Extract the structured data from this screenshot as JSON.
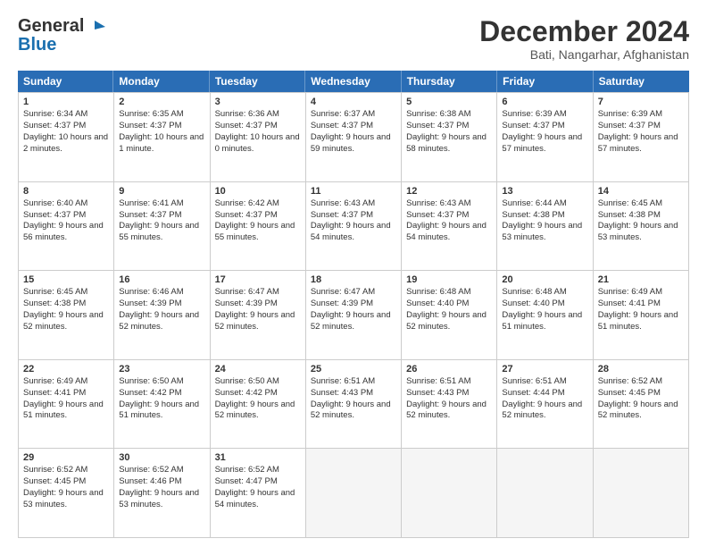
{
  "header": {
    "logo_general": "General",
    "logo_blue": "Blue",
    "month_title": "December 2024",
    "subtitle": "Bati, Nangarhar, Afghanistan"
  },
  "weekdays": [
    "Sunday",
    "Monday",
    "Tuesday",
    "Wednesday",
    "Thursday",
    "Friday",
    "Saturday"
  ],
  "weeks": [
    [
      {
        "day": "1",
        "sunrise": "6:34 AM",
        "sunset": "4:37 PM",
        "daylight": "10 hours and 2 minutes."
      },
      {
        "day": "2",
        "sunrise": "6:35 AM",
        "sunset": "4:37 PM",
        "daylight": "10 hours and 1 minute."
      },
      {
        "day": "3",
        "sunrise": "6:36 AM",
        "sunset": "4:37 PM",
        "daylight": "10 hours and 0 minutes."
      },
      {
        "day": "4",
        "sunrise": "6:37 AM",
        "sunset": "4:37 PM",
        "daylight": "9 hours and 59 minutes."
      },
      {
        "day": "5",
        "sunrise": "6:38 AM",
        "sunset": "4:37 PM",
        "daylight": "9 hours and 58 minutes."
      },
      {
        "day": "6",
        "sunrise": "6:39 AM",
        "sunset": "4:37 PM",
        "daylight": "9 hours and 57 minutes."
      },
      {
        "day": "7",
        "sunrise": "6:39 AM",
        "sunset": "4:37 PM",
        "daylight": "9 hours and 57 minutes."
      }
    ],
    [
      {
        "day": "8",
        "sunrise": "6:40 AM",
        "sunset": "4:37 PM",
        "daylight": "9 hours and 56 minutes."
      },
      {
        "day": "9",
        "sunrise": "6:41 AM",
        "sunset": "4:37 PM",
        "daylight": "9 hours and 55 minutes."
      },
      {
        "day": "10",
        "sunrise": "6:42 AM",
        "sunset": "4:37 PM",
        "daylight": "9 hours and 55 minutes."
      },
      {
        "day": "11",
        "sunrise": "6:43 AM",
        "sunset": "4:37 PM",
        "daylight": "9 hours and 54 minutes."
      },
      {
        "day": "12",
        "sunrise": "6:43 AM",
        "sunset": "4:37 PM",
        "daylight": "9 hours and 54 minutes."
      },
      {
        "day": "13",
        "sunrise": "6:44 AM",
        "sunset": "4:38 PM",
        "daylight": "9 hours and 53 minutes."
      },
      {
        "day": "14",
        "sunrise": "6:45 AM",
        "sunset": "4:38 PM",
        "daylight": "9 hours and 53 minutes."
      }
    ],
    [
      {
        "day": "15",
        "sunrise": "6:45 AM",
        "sunset": "4:38 PM",
        "daylight": "9 hours and 52 minutes."
      },
      {
        "day": "16",
        "sunrise": "6:46 AM",
        "sunset": "4:39 PM",
        "daylight": "9 hours and 52 minutes."
      },
      {
        "day": "17",
        "sunrise": "6:47 AM",
        "sunset": "4:39 PM",
        "daylight": "9 hours and 52 minutes."
      },
      {
        "day": "18",
        "sunrise": "6:47 AM",
        "sunset": "4:39 PM",
        "daylight": "9 hours and 52 minutes."
      },
      {
        "day": "19",
        "sunrise": "6:48 AM",
        "sunset": "4:40 PM",
        "daylight": "9 hours and 52 minutes."
      },
      {
        "day": "20",
        "sunrise": "6:48 AM",
        "sunset": "4:40 PM",
        "daylight": "9 hours and 51 minutes."
      },
      {
        "day": "21",
        "sunrise": "6:49 AM",
        "sunset": "4:41 PM",
        "daylight": "9 hours and 51 minutes."
      }
    ],
    [
      {
        "day": "22",
        "sunrise": "6:49 AM",
        "sunset": "4:41 PM",
        "daylight": "9 hours and 51 minutes."
      },
      {
        "day": "23",
        "sunrise": "6:50 AM",
        "sunset": "4:42 PM",
        "daylight": "9 hours and 51 minutes."
      },
      {
        "day": "24",
        "sunrise": "6:50 AM",
        "sunset": "4:42 PM",
        "daylight": "9 hours and 52 minutes."
      },
      {
        "day": "25",
        "sunrise": "6:51 AM",
        "sunset": "4:43 PM",
        "daylight": "9 hours and 52 minutes."
      },
      {
        "day": "26",
        "sunrise": "6:51 AM",
        "sunset": "4:43 PM",
        "daylight": "9 hours and 52 minutes."
      },
      {
        "day": "27",
        "sunrise": "6:51 AM",
        "sunset": "4:44 PM",
        "daylight": "9 hours and 52 minutes."
      },
      {
        "day": "28",
        "sunrise": "6:52 AM",
        "sunset": "4:45 PM",
        "daylight": "9 hours and 52 minutes."
      }
    ],
    [
      {
        "day": "29",
        "sunrise": "6:52 AM",
        "sunset": "4:45 PM",
        "daylight": "9 hours and 53 minutes."
      },
      {
        "day": "30",
        "sunrise": "6:52 AM",
        "sunset": "4:46 PM",
        "daylight": "9 hours and 53 minutes."
      },
      {
        "day": "31",
        "sunrise": "6:52 AM",
        "sunset": "4:47 PM",
        "daylight": "9 hours and 54 minutes."
      },
      null,
      null,
      null,
      null
    ]
  ]
}
